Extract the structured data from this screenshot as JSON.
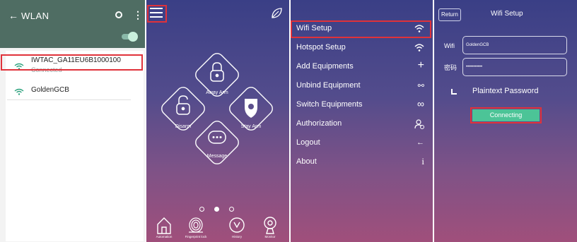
{
  "wlan": {
    "back_glyph": "←",
    "title": "WLAN",
    "more_glyph": "⋮",
    "networks": [
      {
        "name": "IWTAC_GA11EU6B1000100",
        "status": "Connected"
      },
      {
        "name": "GoldenGCB",
        "status": ""
      }
    ],
    "colors": {
      "header": "#4f6d63",
      "wifi": "#2fa37f"
    }
  },
  "home": {
    "tiles": [
      {
        "label": "Away Arm",
        "icon": "padlock-closed-icon"
      },
      {
        "label": "Disarm",
        "icon": "padlock-open-icon"
      },
      {
        "label": "Stay Arm",
        "icon": "shield-icon"
      },
      {
        "label": "Message",
        "icon": "message-bubble-icon"
      }
    ],
    "nav": [
      {
        "label": "Automation",
        "icon": "home-icon"
      },
      {
        "label": "Fingerprint lock",
        "icon": "fingerprint-icon"
      },
      {
        "label": "History",
        "icon": "history-icon"
      },
      {
        "label": "Monitor",
        "icon": "camera-icon"
      }
    ],
    "page_indicator": {
      "count": 3,
      "active": 2
    }
  },
  "menu": {
    "items": [
      {
        "label": "Wifi Setup",
        "icon": "wifi-icon",
        "glyph": ""
      },
      {
        "label": "Hotspot Setup",
        "icon": "wifi-icon",
        "glyph": ""
      },
      {
        "label": "Add Equipments",
        "icon": "plus-icon",
        "glyph": "+"
      },
      {
        "label": "Unbind Equipment",
        "icon": "unlink-icon",
        "glyph": "⚯"
      },
      {
        "label": "Switch Equipments",
        "icon": "infinity-icon",
        "glyph": "∞"
      },
      {
        "label": "Authorization",
        "icon": "add-user-icon",
        "glyph": ""
      },
      {
        "label": "Logout",
        "icon": "arrow-left-icon",
        "glyph": "←"
      },
      {
        "label": "About",
        "icon": "info-icon",
        "glyph": "i"
      }
    ]
  },
  "wifi_setup": {
    "return_label": "Return",
    "title": "Wifi Setup",
    "wifi_label": "Wifi",
    "wifi_value": "GoldenGCB",
    "password_label": "密码",
    "password_value": "•••••••••••",
    "plaintext_label": "Plaintext Password",
    "connect_label": "Connecting",
    "colors": {
      "button": "#4cc497",
      "highlight": "#e0323a"
    }
  }
}
